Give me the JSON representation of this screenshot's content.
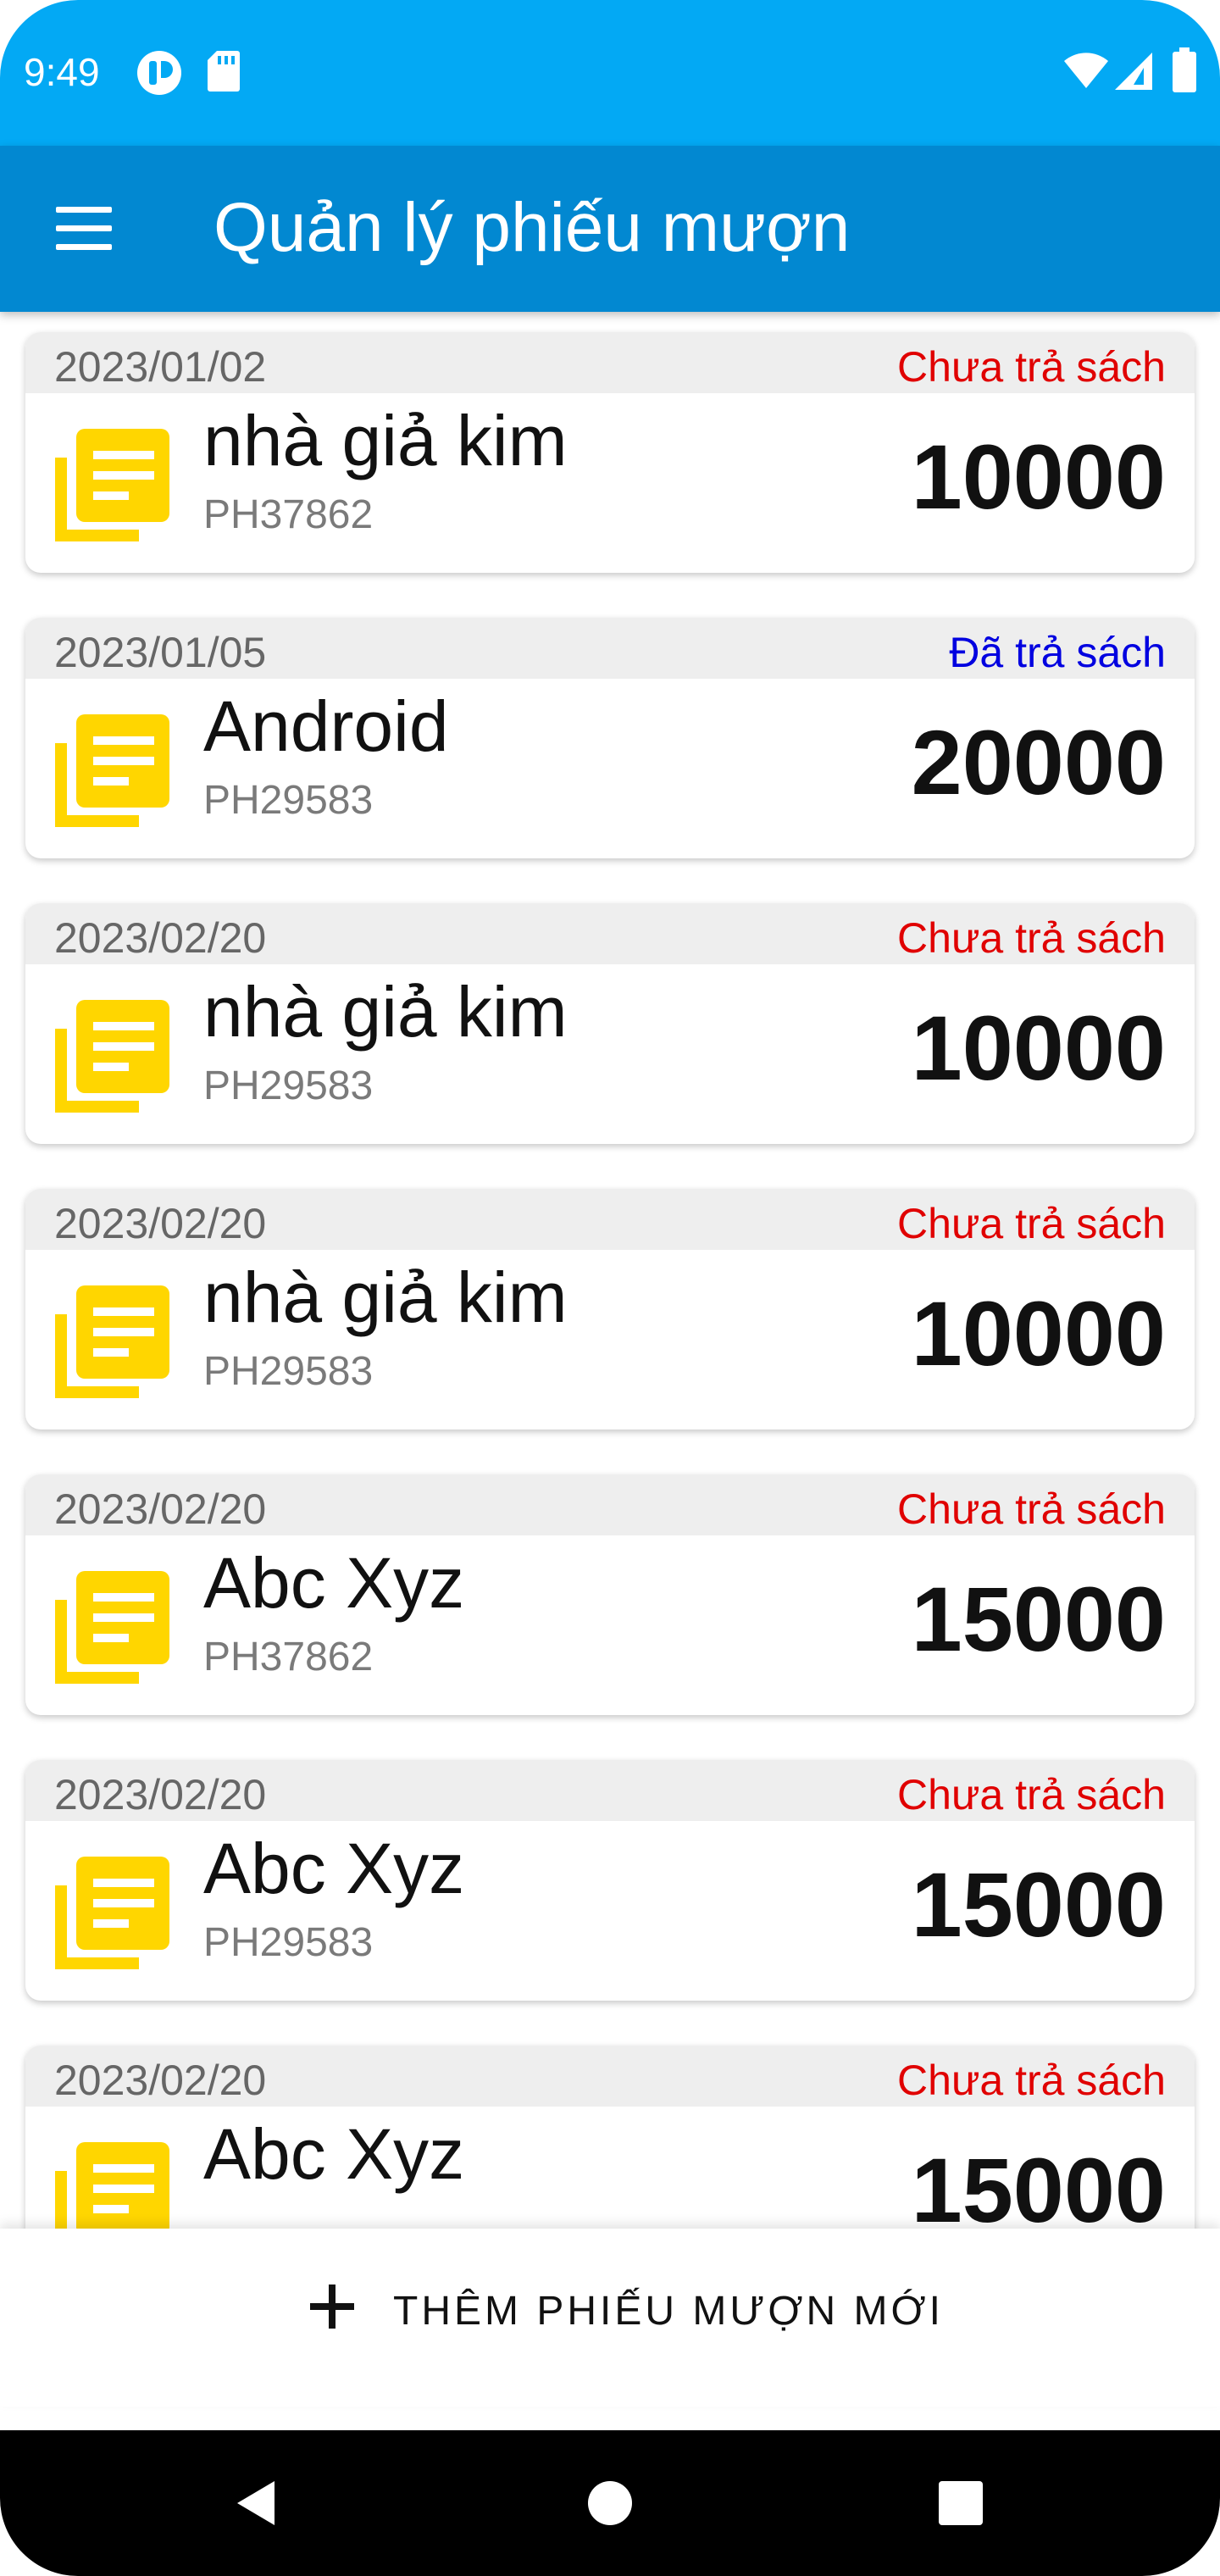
{
  "status_bar": {
    "time": "9:49",
    "icons": [
      "app-notification-icon",
      "sd-card-icon",
      "wifi-icon",
      "cellular-signal-icon",
      "battery-icon"
    ]
  },
  "app_bar": {
    "title": "Quản lý phiếu mượn",
    "menu_icon": "hamburger-menu-icon"
  },
  "colors": {
    "status_bar": "#03a9f4",
    "app_bar": "#0288d1",
    "icon_yellow": "#ffd600",
    "status_not_returned": "#e00000",
    "status_returned": "#0000e0"
  },
  "loans": [
    {
      "date": "2023/01/02",
      "status": "Chưa trả sách",
      "returned": false,
      "book": "nhà giả kim",
      "member": "PH37862",
      "price": "10000"
    },
    {
      "date": "2023/01/05",
      "status": "Đã trả sách",
      "returned": true,
      "book": "Android",
      "member": "PH29583",
      "price": "20000"
    },
    {
      "date": "2023/02/20",
      "status": "Chưa trả sách",
      "returned": false,
      "book": "nhà giả kim",
      "member": "PH29583",
      "price": "10000"
    },
    {
      "date": "2023/02/20",
      "status": "Chưa trả sách",
      "returned": false,
      "book": "nhà giả kim",
      "member": "PH29583",
      "price": "10000"
    },
    {
      "date": "2023/02/20",
      "status": "Chưa trả sách",
      "returned": false,
      "book": "Abc Xyz",
      "member": "PH37862",
      "price": "15000"
    },
    {
      "date": "2023/02/20",
      "status": "Chưa trả sách",
      "returned": false,
      "book": "Abc Xyz",
      "member": "PH29583",
      "price": "15000"
    },
    {
      "date": "2023/02/20",
      "status": "Chưa trả sách",
      "returned": false,
      "book": "Abc Xyz",
      "member": "",
      "price": "15000"
    }
  ],
  "add_button": {
    "label": "THÊM PHIẾU MƯỢN MỚI",
    "icon": "plus-icon"
  },
  "nav_bar": {
    "buttons": [
      "back-icon",
      "home-icon",
      "recents-icon"
    ]
  }
}
